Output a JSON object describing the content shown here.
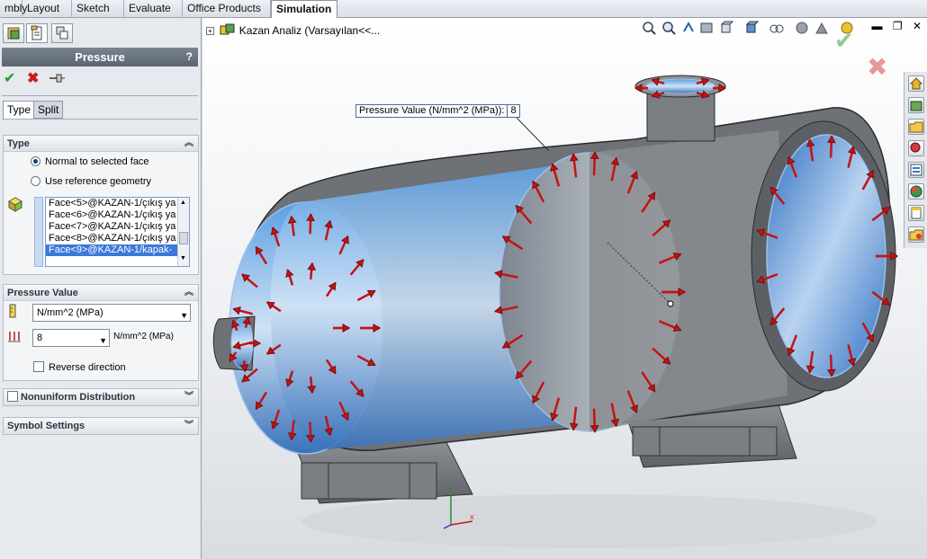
{
  "ribbon": {
    "tabs": [
      {
        "label": "mbly",
        "active": false
      },
      {
        "label": "Layout",
        "active": false
      },
      {
        "label": "Sketch",
        "active": false
      },
      {
        "label": "Evaluate",
        "active": false
      },
      {
        "label": "Office Products",
        "active": false
      },
      {
        "label": "Simulation",
        "active": true
      }
    ]
  },
  "property_manager": {
    "title": "Pressure",
    "help": "?",
    "tabs": [
      "Type",
      "Split"
    ],
    "type_group": {
      "header": "Type",
      "options": [
        "Normal to selected face",
        "Use reference geometry"
      ],
      "selected_option": 0,
      "faces": [
        "Face<5>@KAZAN-1/çıkış ya",
        "Face<6>@KAZAN-1/çıkış ya",
        "Face<7>@KAZAN-1/çıkış ya",
        "Face<8>@KAZAN-1/çıkış ya",
        "Face<9>@KAZAN-1/kapak-"
      ],
      "selected_face": 4
    },
    "pressure_group": {
      "header": "Pressure Value",
      "unit": "N/mm^2 (MPa)",
      "value": "8",
      "value_unit": "N/mm^2 (MPa)",
      "reverse_label": "Reverse direction"
    },
    "nonuniform": {
      "label": "Nonuniform Distribution"
    },
    "symbol": {
      "label": "Symbol Settings"
    }
  },
  "viewport": {
    "tree_root": "Kazan Analiz  (Varsayılan<<...",
    "callout_label": "Pressure Value (N/mm^2 (MPa)):",
    "callout_value": "8"
  },
  "colors": {
    "arrow": "#c41414",
    "interior_blue": "#3b7fc9",
    "shell_gray": "#6b6b6b"
  }
}
